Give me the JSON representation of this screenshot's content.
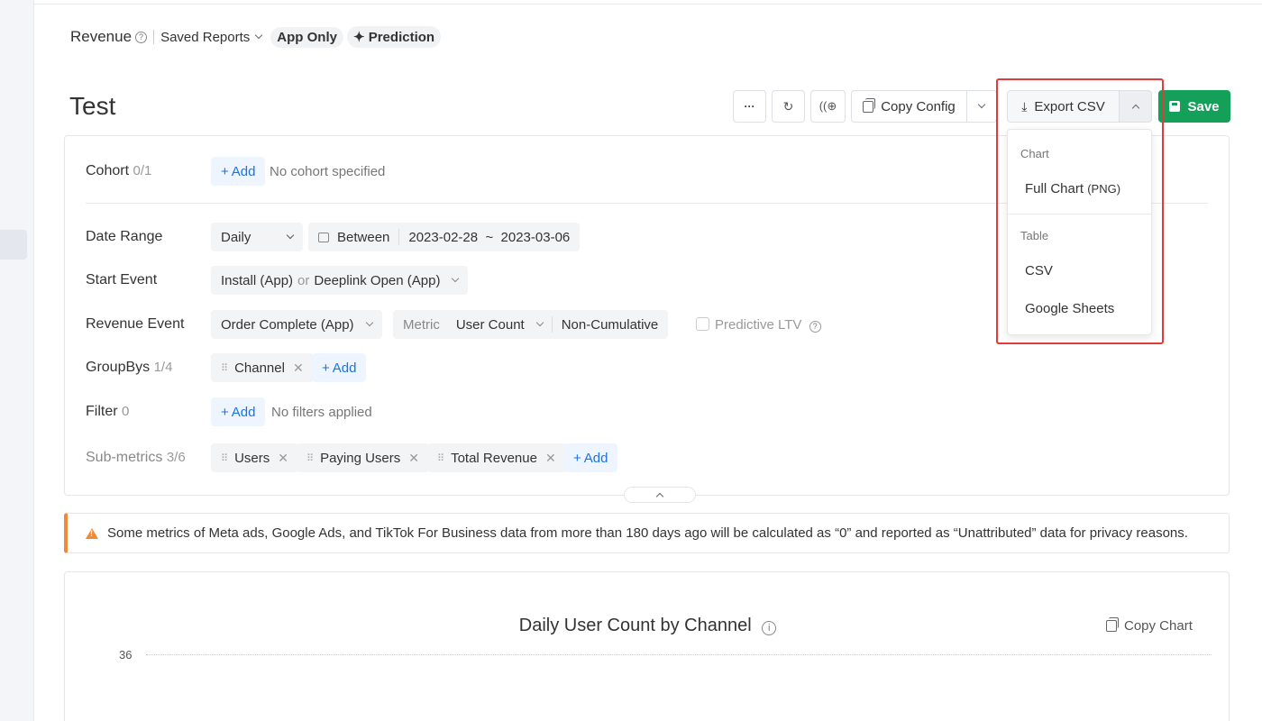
{
  "breadcrumb": {
    "title": "Revenue",
    "saved_reports": "Saved Reports",
    "app_only": "App Only",
    "prediction": "Prediction"
  },
  "page": {
    "title": "Test"
  },
  "toolbar": {
    "more_label": "···",
    "copy_config": "Copy Config",
    "export_csv": "Export CSV",
    "save": "Save"
  },
  "export_menu": {
    "chart_header": "Chart",
    "full_chart": "Full Chart",
    "full_chart_suffix": "(PNG)",
    "table_header": "Table",
    "csv": "CSV",
    "google_sheets": "Google Sheets"
  },
  "settings": {
    "add_label": "Add",
    "cohort": {
      "label": "Cohort",
      "count": "0/1",
      "empty": "No cohort specified"
    },
    "date_range": {
      "label": "Date Range",
      "granularity": "Daily",
      "mode": "Between",
      "range": "2023-02-28  ~  2023-03-06"
    },
    "start_event": {
      "label": "Start Event",
      "event_a": "Install (App)",
      "or": "or",
      "event_b": "Deeplink Open (App)"
    },
    "revenue_event": {
      "label": "Revenue Event",
      "event": "Order Complete (App)",
      "metric_label": "Metric",
      "metric": "User Count",
      "mode": "Non-Cumulative",
      "predictive": "Predictive LTV"
    },
    "groupbys": {
      "label": "GroupBys",
      "count": "1/4",
      "items": [
        "Channel"
      ]
    },
    "filter": {
      "label": "Filter",
      "count": "0",
      "empty": "No filters applied"
    },
    "sub_metrics": {
      "label": "Sub-metrics",
      "count": "3/6",
      "items": [
        "Users",
        "Paying Users",
        "Total Revenue"
      ]
    }
  },
  "warning": {
    "text": "Some metrics of Meta ads, Google Ads, and TikTok For Business data from more than 180 days ago will be calculated as “0” and reported as “Unattributed” data for privacy reasons.",
    "color": "#f08a38"
  },
  "chart": {
    "title": "Daily User Count by Channel",
    "copy_chart": "Copy Chart",
    "y_tick_top": "36"
  },
  "colors": {
    "accent_green": "#15a05a",
    "link_blue": "#1a73e8",
    "highlight_red": "#e33b3b"
  }
}
